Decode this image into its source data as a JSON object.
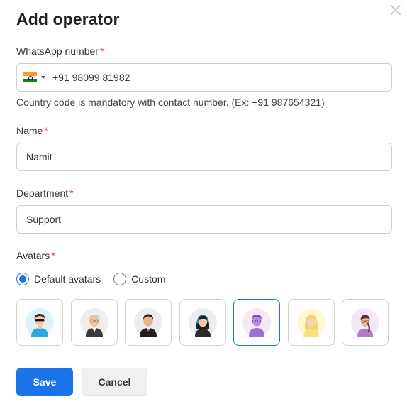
{
  "dialog": {
    "title": "Add operator",
    "close_icon": "close-icon"
  },
  "whatsapp": {
    "label": "WhatsApp number",
    "required_mark": "*",
    "country_flag": "india-flag-icon",
    "value": "+91 98099 81982",
    "hint": "Country code is mandatory with contact number. (Ex: +91 987654321)"
  },
  "name": {
    "label": "Name",
    "required_mark": "*",
    "value": "Namit"
  },
  "department": {
    "label": "Department",
    "required_mark": "*",
    "value": "Support"
  },
  "avatars": {
    "label": "Avatars",
    "required_mark": "*",
    "options": [
      {
        "label": "Default avatars",
        "checked": true
      },
      {
        "label": "Custom",
        "checked": false
      }
    ],
    "selected_index": 4,
    "items": [
      "avatar-boy-sunglasses-icon",
      "avatar-old-man-icon",
      "avatar-man-suit-icon",
      "avatar-woman-headset-icon",
      "avatar-purple-person-icon",
      "avatar-blonde-woman-icon",
      "avatar-woman-braid-icon"
    ]
  },
  "actions": {
    "save_label": "Save",
    "cancel_label": "Cancel"
  },
  "colors": {
    "accent": "#1a73e8",
    "required": "#e5484d",
    "border": "#cfcfcf"
  }
}
